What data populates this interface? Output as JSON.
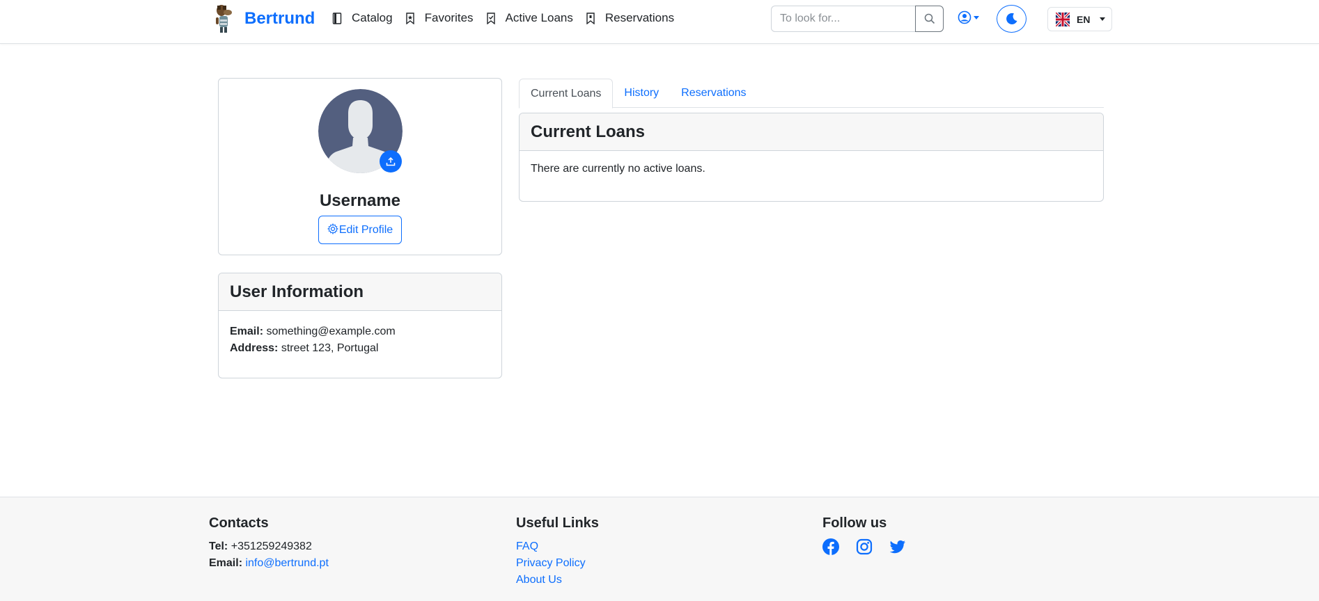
{
  "navbar": {
    "brand": "Bertrund",
    "links": [
      "Catalog",
      "Favorites",
      "Active Loans",
      "Reservations"
    ],
    "search_placeholder": "To look for...",
    "language": "EN"
  },
  "profile": {
    "username": "Username",
    "edit_label": "Edit Profile"
  },
  "user_info": {
    "title": "User Information",
    "email_label": "Email:",
    "email_value": "something@example.com",
    "address_label": "Address:",
    "address_value": "street 123, Portugal"
  },
  "tabs": [
    "Current Loans",
    "History",
    "Reservations"
  ],
  "loans": {
    "title": "Current Loans",
    "message": "There are currently no active loans."
  },
  "footer": {
    "contacts_title": "Contacts",
    "tel_label": "Tel:",
    "tel_value": "+351259249382",
    "email_label": "Email:",
    "email_value": "info@bertrund.pt",
    "links_title": "Useful Links",
    "links": [
      "FAQ",
      "Privacy Policy",
      "About Us"
    ],
    "follow_title": "Follow us",
    "social_icons": [
      "facebook-icon",
      "instagram-icon",
      "twitter-icon"
    ]
  },
  "colors": {
    "primary": "#0d6efd",
    "avatar_bg": "#535f7f",
    "card_header_bg": "#f7f7f7"
  }
}
